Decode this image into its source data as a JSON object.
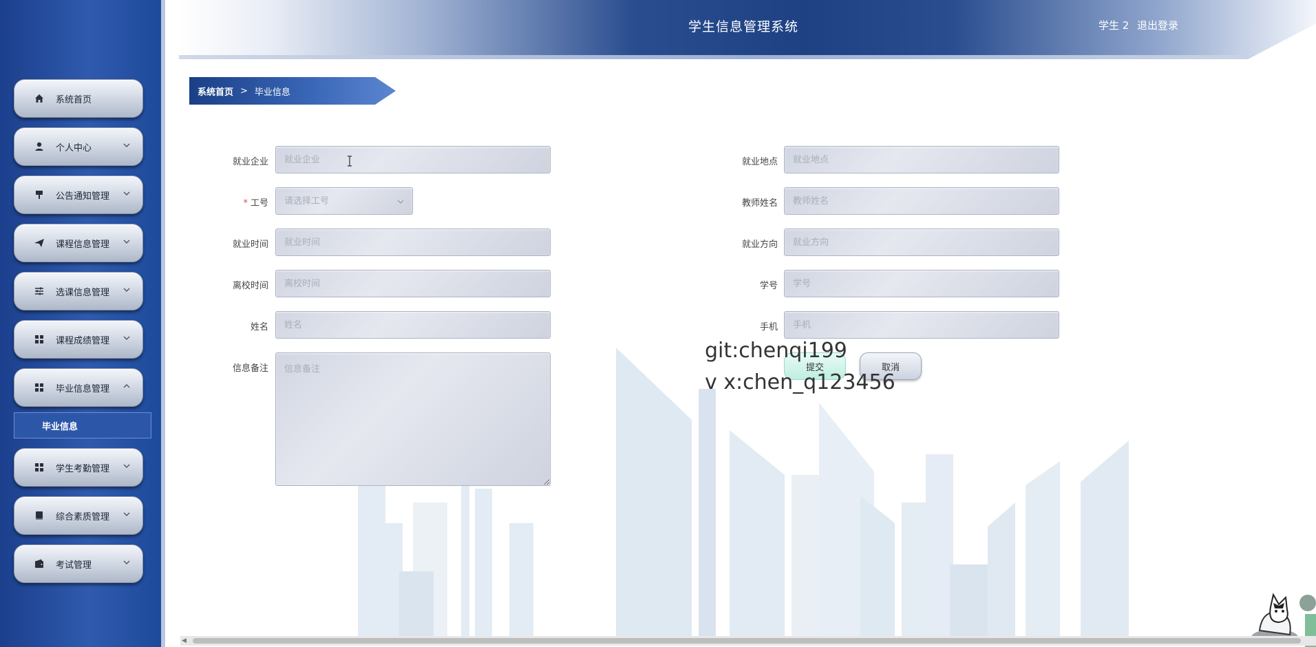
{
  "header": {
    "title": "学生信息管理系统",
    "user": "学生 2",
    "logout": "退出登录"
  },
  "sidebar": {
    "items": [
      {
        "label": "系统首页",
        "icon": "home-icon",
        "has_chevron": false
      },
      {
        "label": "个人中心",
        "icon": "user-icon",
        "has_chevron": true
      },
      {
        "label": "公告通知管理",
        "icon": "notice-icon",
        "has_chevron": true
      },
      {
        "label": "课程信息管理",
        "icon": "send-icon",
        "has_chevron": true
      },
      {
        "label": "选课信息管理",
        "icon": "sliders-icon",
        "has_chevron": true
      },
      {
        "label": "课程成绩管理",
        "icon": "grid-icon",
        "has_chevron": true
      },
      {
        "label": "毕业信息管理",
        "icon": "grid-icon",
        "has_chevron": true,
        "expanded": true
      },
      {
        "label": "学生考勤管理",
        "icon": "grid-icon",
        "has_chevron": true
      },
      {
        "label": "综合素质管理",
        "icon": "book-icon",
        "has_chevron": true
      },
      {
        "label": "考试管理",
        "icon": "wallet-icon",
        "has_chevron": true
      }
    ],
    "submenu": {
      "label": "毕业信息"
    }
  },
  "breadcrumb": {
    "home": "系统首页",
    "separator": ">",
    "current": "毕业信息"
  },
  "form": {
    "left": [
      {
        "label": "就业企业",
        "placeholder": "就业企业",
        "value": ""
      },
      {
        "label": "工号",
        "placeholder": "请选择工号",
        "required": true,
        "type": "select"
      },
      {
        "label": "就业时间",
        "placeholder": "就业时间",
        "value": ""
      },
      {
        "label": "离校时间",
        "placeholder": "离校时间",
        "value": ""
      },
      {
        "label": "姓名",
        "placeholder": "姓名",
        "value": ""
      },
      {
        "label": "信息备注",
        "placeholder": "信息备注",
        "type": "textarea"
      }
    ],
    "right": [
      {
        "label": "就业地点",
        "placeholder": "就业地点",
        "value": ""
      },
      {
        "label": "教师姓名",
        "placeholder": "教师姓名",
        "value": ""
      },
      {
        "label": "就业方向",
        "placeholder": "就业方向",
        "value": ""
      },
      {
        "label": "学号",
        "placeholder": "学号",
        "value": ""
      },
      {
        "label": "手机",
        "placeholder": "手机",
        "value": ""
      }
    ],
    "required_mark": "*",
    "submit": "提交",
    "cancel": "取消"
  },
  "overlay": {
    "line1": "git:chenqi199",
    "line2": "v x:chen_q123456"
  },
  "colors": {
    "sidebar": "#2f5aad",
    "header_dark": "#1e4184",
    "required": "#e24a4a",
    "submit": "#bfeee0"
  }
}
